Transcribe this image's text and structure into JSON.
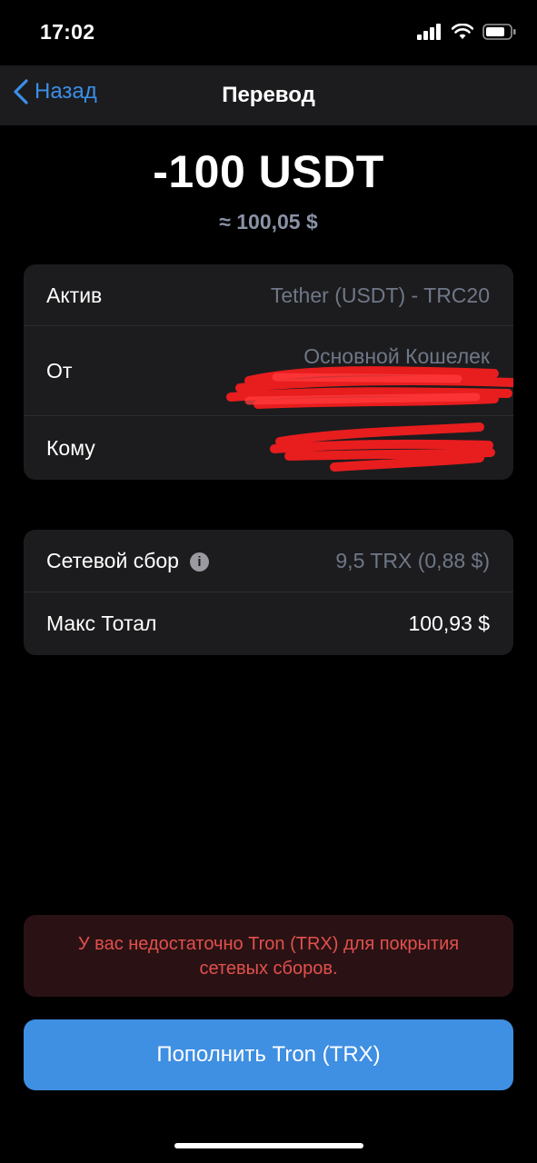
{
  "status": {
    "time": "17:02"
  },
  "nav": {
    "back_label": "Назад",
    "title": "Перевод"
  },
  "transfer": {
    "amount": "-100 USDT",
    "approx": "≈ 100,05 $"
  },
  "details": {
    "asset_label": "Актив",
    "asset_value": "Tether (USDT) - TRC20",
    "from_label": "От",
    "from_value": "Основной Кошелек",
    "to_label": "Кому"
  },
  "fees": {
    "fee_label": "Сетевой сбор",
    "fee_value": "9,5 TRX (0,88 $)",
    "total_label": "Макс Тотал",
    "total_value": "100,93 $"
  },
  "warning": {
    "text": "У вас недостаточно Tron (TRX) для покрытия сетевых сборов."
  },
  "cta": {
    "label": "Пополнить Tron (TRX)"
  },
  "colors": {
    "accent": "#3f8fe2",
    "warning": "#e2504c",
    "redaction": "#ff1e1e"
  }
}
